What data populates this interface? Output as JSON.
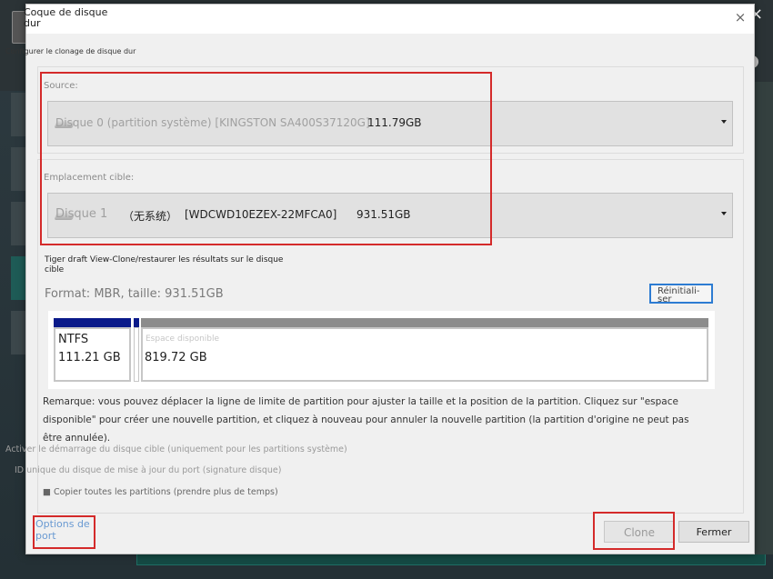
{
  "background_app": {
    "close_glyph": "×",
    "help_glyph": "?",
    "ghost_lines": [
      "Activer le démarrage du disque cible (uniquement pour les partitions système)",
      "ID unique du disque de mise à jour du port (signature disque)"
    ]
  },
  "dialog": {
    "title": "Coque de disque dur",
    "subtitle": "Configurer le clonage de disque dur",
    "close_glyph": "×",
    "source": {
      "label": "Source:",
      "icon": "disk-icon",
      "disk_text": "Disque 0 (partition système) [KINGSTON SA400S37120G]",
      "size": "111.79GB"
    },
    "target": {
      "label": "Emplacement cible:",
      "icon": "disk-icon",
      "disk_name": "Disque 1",
      "system_tag": "（无系统）",
      "model": "[WDCWD10EZEX-22MFCA0]",
      "size": "931.51GB"
    },
    "instruction": "Tiger draft View-Clone/restaurer les résultats sur le disque cible",
    "format_line": "Format: MBR, taille: 931.51GB",
    "reset_label": "Réinitiali-ser",
    "partitions": [
      {
        "fs": "NTFS",
        "size": "111.21 GB",
        "bar_color": "#0a1a8a"
      },
      {
        "fs": "",
        "size": "",
        "bar_color": "#0a1a8a"
      },
      {
        "fs": "Espace disponible",
        "size": "819.72 GB",
        "bar_color": "#8c8c8c"
      }
    ],
    "note": "Remarque: vous pouvez déplacer la ligne de limite de partition pour ajuster la taille et la position de la partition. Cliquez sur \"espace disponible\" pour créer une nouvelle partition, et cliquez à nouveau pour annuler la nouvelle partition (la partition d'origine ne peut pas être annulée).",
    "options": {
      "boot": "Activer le démarrage du disque cible (uniquement pour les partitions système)",
      "signature": "ID unique du disque de mise à jour du port (signature disque)",
      "copy_all": "■ Copier toutes les partitions (prendre plus de temps)"
    },
    "port_options_label": "Options de port",
    "clone_label": "Clone",
    "close_label": "Fermer"
  },
  "colors": {
    "accent_red": "#d42a2a",
    "accent_blue": "#2d7cd2",
    "partition_used": "#0a1a8a",
    "partition_free": "#8c8c8c"
  }
}
